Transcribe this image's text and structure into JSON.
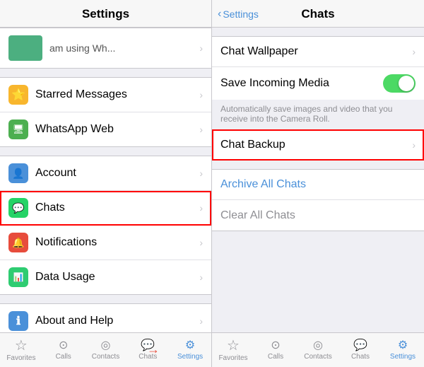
{
  "left": {
    "header": {
      "title": "Settings"
    },
    "profile": {
      "status": "am using Wh..."
    },
    "sections": [
      {
        "items": [
          {
            "id": "starred",
            "icon": "⭐",
            "iconClass": "icon-yellow",
            "label": "Starred Messages"
          },
          {
            "id": "whatsapp-web",
            "icon": "🖥",
            "iconClass": "icon-green",
            "label": "WhatsApp Web"
          }
        ]
      },
      {
        "items": [
          {
            "id": "account",
            "icon": "👤",
            "iconClass": "icon-blue",
            "label": "Account"
          },
          {
            "id": "chats",
            "icon": "💬",
            "iconClass": "icon-chat highlighted",
            "label": "Chats",
            "highlight": true
          },
          {
            "id": "notifications",
            "icon": "🔔",
            "iconClass": "icon-red",
            "label": "Notifications"
          },
          {
            "id": "data-usage",
            "icon": "📊",
            "iconClass": "icon-teal",
            "label": "Data Usage"
          }
        ]
      },
      {
        "items": [
          {
            "id": "about-help",
            "icon": "ℹ",
            "iconClass": "icon-info",
            "label": "About and Help"
          }
        ]
      }
    ],
    "tabs": [
      {
        "id": "favorites",
        "icon": "☆",
        "label": "Favorites"
      },
      {
        "id": "calls",
        "icon": "○",
        "label": "Calls"
      },
      {
        "id": "contacts",
        "icon": "◎",
        "label": "Contacts"
      },
      {
        "id": "chats",
        "icon": "💬",
        "label": "Chats"
      },
      {
        "id": "settings",
        "icon": "⚙",
        "label": "Settings",
        "active": true
      }
    ]
  },
  "right": {
    "header": {
      "back_label": "Settings",
      "title": "Chats"
    },
    "sections": [
      {
        "items": [
          {
            "id": "chat-wallpaper",
            "label": "Chat Wallpaper",
            "type": "chevron"
          },
          {
            "id": "save-incoming-media",
            "label": "Save Incoming Media",
            "type": "toggle",
            "description": "Automatically save images and video that you receive into the Camera Roll."
          },
          {
            "id": "chat-backup",
            "label": "Chat Backup",
            "type": "chevron",
            "highlight": true
          }
        ]
      },
      {
        "items": [
          {
            "id": "archive-all-chats",
            "label": "Archive All Chats",
            "type": "action-blue"
          },
          {
            "id": "clear-all-chats",
            "label": "Clear All Chats",
            "type": "action-gray"
          }
        ]
      }
    ],
    "tabs": [
      {
        "id": "favorites",
        "icon": "☆",
        "label": "Favorites"
      },
      {
        "id": "calls",
        "icon": "○",
        "label": "Calls"
      },
      {
        "id": "contacts",
        "icon": "◎",
        "label": "Contacts"
      },
      {
        "id": "chats",
        "icon": "💬",
        "label": "Chats"
      },
      {
        "id": "settings",
        "icon": "⚙",
        "label": "Settings",
        "active": true
      }
    ]
  }
}
